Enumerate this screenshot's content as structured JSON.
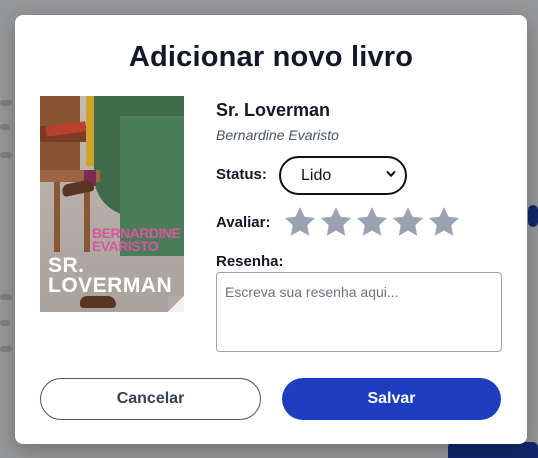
{
  "modal": {
    "title": "Adicionar novo livro"
  },
  "book": {
    "title": "Sr. Loverman",
    "author": "Bernardine Evaristo",
    "cover": {
      "author_text": "BERNARDINE\nEVARISTO",
      "title_text": "SR.\nLOVERMAN"
    }
  },
  "form": {
    "status_label": "Status:",
    "status_value": "Lido",
    "rating_label": "Avaliar:",
    "rating": 0,
    "rating_max": 5,
    "review_label": "Resenha:",
    "review_placeholder": "Escreva sua resenha aqui..."
  },
  "actions": {
    "cancel_label": "Cancelar",
    "save_label": "Salvar"
  },
  "colors": {
    "primary": "#1d3fbf",
    "star_inactive": "#9aa3b2",
    "overlay": "rgba(0,0,0,0.38)"
  }
}
